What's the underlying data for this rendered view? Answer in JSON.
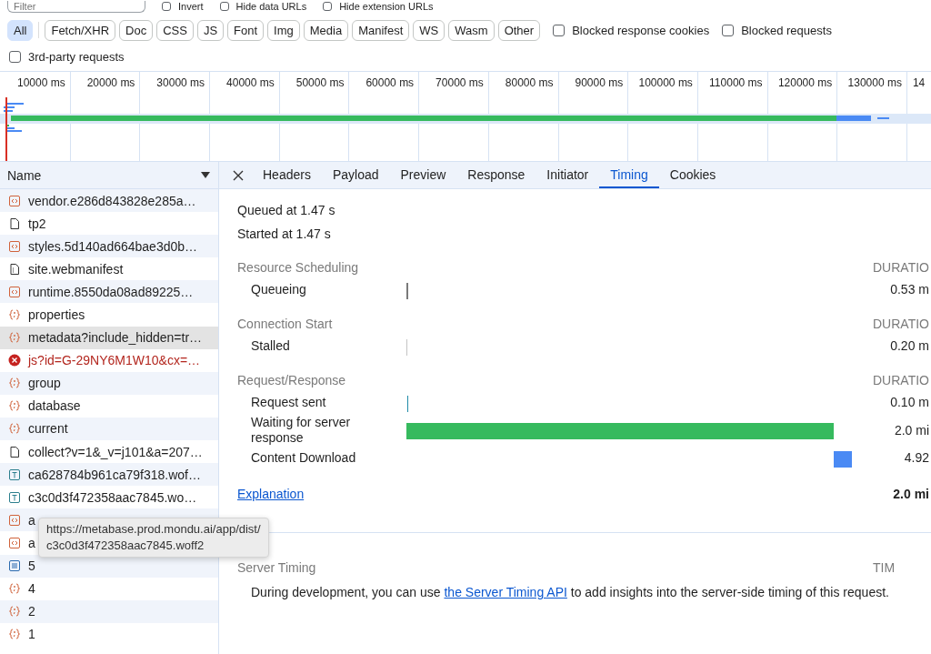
{
  "toolbar": {
    "filter": {
      "placeholder": "Filter"
    },
    "options": [
      {
        "label": "Invert",
        "checked": false
      },
      {
        "label": "Hide data URLs",
        "checked": false
      },
      {
        "label": "Hide extension URLs",
        "checked": false
      }
    ]
  },
  "type_filters": [
    {
      "label": "All",
      "selected": true
    },
    {
      "label": "Fetch/XHR",
      "selected": false
    },
    {
      "label": "Doc",
      "selected": false
    },
    {
      "label": "CSS",
      "selected": false
    },
    {
      "label": "JS",
      "selected": false
    },
    {
      "label": "Font",
      "selected": false
    },
    {
      "label": "Img",
      "selected": false
    },
    {
      "label": "Media",
      "selected": false
    },
    {
      "label": "Manifest",
      "selected": false
    },
    {
      "label": "WS",
      "selected": false
    },
    {
      "label": "Wasm",
      "selected": false
    },
    {
      "label": "Other",
      "selected": false
    }
  ],
  "filter_options": [
    {
      "label": "Blocked response cookies",
      "checked": false
    },
    {
      "label": "Blocked requests",
      "checked": false
    },
    {
      "label": "3rd-party requests",
      "checked": false
    }
  ],
  "overview": {
    "ticks": [
      "10000 ms",
      "20000 ms",
      "30000 ms",
      "40000 ms",
      "50000 ms",
      "60000 ms",
      "70000 ms",
      "80000 ms",
      "90000 ms",
      "100000 ms",
      "110000 ms",
      "120000 ms",
      "130000 ms",
      "14"
    ]
  },
  "requests": {
    "column": "Name",
    "rows": [
      {
        "name": "vendor.e286d843828e285a…",
        "kind": "script",
        "selected": false,
        "failed": false
      },
      {
        "name": "tp2",
        "kind": "document",
        "selected": false,
        "failed": false
      },
      {
        "name": "styles.5d140ad664bae3d0b…",
        "kind": "script",
        "selected": false,
        "failed": false
      },
      {
        "name": "site.webmanifest",
        "kind": "manifest",
        "selected": false,
        "failed": false
      },
      {
        "name": "runtime.8550da08ad89225…",
        "kind": "script",
        "selected": false,
        "failed": false
      },
      {
        "name": "properties",
        "kind": "fetch",
        "selected": false,
        "failed": false
      },
      {
        "name": "metadata?include_hidden=tr…",
        "kind": "fetch",
        "selected": true,
        "failed": false
      },
      {
        "name": "js?id=G-29NY6M1W10&cx=…",
        "kind": "error",
        "selected": false,
        "failed": true
      },
      {
        "name": "group",
        "kind": "fetch",
        "selected": false,
        "failed": false
      },
      {
        "name": "database",
        "kind": "fetch",
        "selected": false,
        "failed": false
      },
      {
        "name": "current",
        "kind": "fetch",
        "selected": false,
        "failed": false
      },
      {
        "name": "collect?v=1&_v=j101&a=207…",
        "kind": "document",
        "selected": false,
        "failed": false
      },
      {
        "name": "ca628784b961ca79f318.wof…",
        "kind": "font",
        "selected": false,
        "failed": false
      },
      {
        "name": "c3c0d3f472358aac7845.wo…",
        "kind": "font",
        "selected": false,
        "failed": false
      },
      {
        "name": "a",
        "kind": "script",
        "selected": false,
        "failed": false
      },
      {
        "name": "a",
        "kind": "script",
        "selected": false,
        "failed": false
      },
      {
        "name": "5",
        "kind": "text",
        "selected": false,
        "failed": false
      },
      {
        "name": "4",
        "kind": "fetch",
        "selected": false,
        "failed": false
      },
      {
        "name": "2",
        "kind": "fetch",
        "selected": false,
        "failed": false
      },
      {
        "name": "1",
        "kind": "fetch",
        "selected": false,
        "failed": false
      }
    ],
    "tooltip": [
      "https://metabase.prod.mondu.ai/app/dist/",
      "c3c0d3f472358aac7845.woff2"
    ]
  },
  "details": {
    "tabs": [
      {
        "label": "Headers",
        "selected": false
      },
      {
        "label": "Payload",
        "selected": false
      },
      {
        "label": "Preview",
        "selected": false
      },
      {
        "label": "Response",
        "selected": false
      },
      {
        "label": "Initiator",
        "selected": false
      },
      {
        "label": "Timing",
        "selected": true
      },
      {
        "label": "Cookies",
        "selected": false
      }
    ],
    "queued": "Queued at 1.47 s",
    "started": "Started at 1.47 s",
    "sections": [
      {
        "title": "Resource Scheduling",
        "column": "DURATIO",
        "phases": [
          {
            "label": "Queueing",
            "duration": "0.53 m",
            "color": "#7a7a7a"
          }
        ]
      },
      {
        "title": "Connection Start",
        "column": "DURATIO",
        "phases": [
          {
            "label": "Stalled",
            "duration": "0.20 m",
            "color": "#c4c4c4"
          }
        ]
      },
      {
        "title": "Request/Response",
        "column": "DURATIO",
        "phases": [
          {
            "label": "Request sent",
            "duration": "0.10 m",
            "color": "#1f8aa8"
          },
          {
            "label": "Waiting for server response",
            "duration": "2.0 mi",
            "color": "#36ba5e"
          },
          {
            "label": "Content Download",
            "duration": "4.92",
            "color": "#4a8af4"
          }
        ]
      }
    ],
    "explanation": "Explanation",
    "total": "2.0 mi",
    "server_timing": {
      "title": "Server Timing",
      "column": "TIM",
      "text": "During development, you can use ",
      "link": "the Server Timing API",
      "text_after": " to add insights into the server-side timing of this request."
    }
  }
}
